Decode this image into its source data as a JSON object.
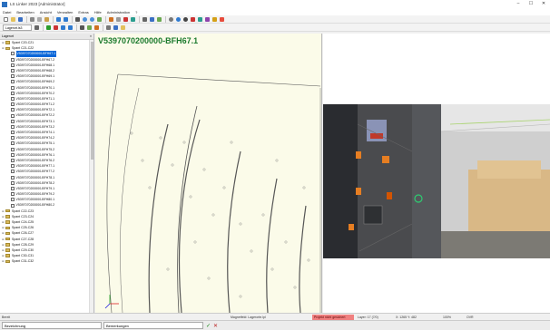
{
  "window": {
    "title": "LS Linker 2023 [Administrator]",
    "min": "–",
    "max": "☐",
    "close": "✕"
  },
  "menu": [
    "Datei",
    "Bearbeiten",
    "Ansicht",
    "Verwalten",
    "Extras",
    "Hilfe",
    "Administration",
    "?"
  ],
  "toolbar3": {
    "group_dropdown": "Lagerort.ls3"
  },
  "tree": {
    "header": "Lagerort",
    "close": "×",
    "items": [
      {
        "label": "Spant C20-C21",
        "type": "folder",
        "level": 0
      },
      {
        "label": "Spant C21-C22",
        "type": "folder",
        "level": 0
      },
      {
        "label": "V5397070200000-BFH67.1",
        "type": "doc",
        "level": 1,
        "selected": true
      },
      {
        "label": "V5397070200000-BFH67.2",
        "type": "doc",
        "level": 1
      },
      {
        "label": "V5397070200000-BFH68.1",
        "type": "doc",
        "level": 1
      },
      {
        "label": "V5397070200000-BFH68.2",
        "type": "doc",
        "level": 1
      },
      {
        "label": "V5397070200000-BFH69.1",
        "type": "doc",
        "level": 1
      },
      {
        "label": "V5397070200000-BFH69.2",
        "type": "doc",
        "level": 1
      },
      {
        "label": "V5397070200000-BFH70.1",
        "type": "doc",
        "level": 1
      },
      {
        "label": "V5397070200000-BFH70.2",
        "type": "doc",
        "level": 1
      },
      {
        "label": "V5397070200000-BFH71.1",
        "type": "doc",
        "level": 1
      },
      {
        "label": "V5397070200000-BFH71.2",
        "type": "doc",
        "level": 1
      },
      {
        "label": "V5397070200000-BFH72.1",
        "type": "doc",
        "level": 1
      },
      {
        "label": "V5397070200000-BFH72.2",
        "type": "doc",
        "level": 1
      },
      {
        "label": "V5397070200000-BFH73.1",
        "type": "doc",
        "level": 1
      },
      {
        "label": "V5397070200000-BFH73.2",
        "type": "doc",
        "level": 1
      },
      {
        "label": "V5397070200000-BFH74.1",
        "type": "doc",
        "level": 1
      },
      {
        "label": "V5397070200000-BFH74.2",
        "type": "doc",
        "level": 1
      },
      {
        "label": "V5397070200000-BFH75.1",
        "type": "doc",
        "level": 1
      },
      {
        "label": "V5397070200000-BFH75.2",
        "type": "doc",
        "level": 1
      },
      {
        "label": "V5397070200000-BFH76.1",
        "type": "doc",
        "level": 1
      },
      {
        "label": "V5397070200000-BFH76.2",
        "type": "doc",
        "level": 1
      },
      {
        "label": "V5397070200000-BFH77.1",
        "type": "doc",
        "level": 1
      },
      {
        "label": "V5397070200000-BFH77.2",
        "type": "doc",
        "level": 1
      },
      {
        "label": "V5397070200000-BFH78.1",
        "type": "doc",
        "level": 1
      },
      {
        "label": "V5397070200000-BFH78.2",
        "type": "doc",
        "level": 1
      },
      {
        "label": "V5397070200000-BFH79.1",
        "type": "doc",
        "level": 1
      },
      {
        "label": "V5397070200000-BFH79.2",
        "type": "doc",
        "level": 1
      },
      {
        "label": "V5397070200000-BFH80.1",
        "type": "doc",
        "level": 1
      },
      {
        "label": "V5397070200000-BFH80.2",
        "type": "doc",
        "level": 1
      },
      {
        "label": "Spant C22-C23",
        "type": "folder",
        "level": 0
      },
      {
        "label": "Spant C23-C24",
        "type": "folder",
        "level": 0
      },
      {
        "label": "Spant C24-C25",
        "type": "folder",
        "level": 0
      },
      {
        "label": "Spant C25-C26",
        "type": "folder",
        "level": 0
      },
      {
        "label": "Spant C26-C27",
        "type": "folder",
        "level": 0
      },
      {
        "label": "Spant C27-C28",
        "type": "folder",
        "level": 0
      },
      {
        "label": "Spant C28-C29",
        "type": "folder",
        "level": 0
      },
      {
        "label": "Spant C29-C30",
        "type": "folder",
        "level": 0
      },
      {
        "label": "Spant C30-C31",
        "type": "folder",
        "level": 0
      },
      {
        "label": "Spant C31-C32",
        "type": "folder",
        "level": 0
      }
    ]
  },
  "viewer2d": {
    "title": "V5397070200000-BFH67.1"
  },
  "status": {
    "left": "Bereit",
    "mid": "Magnetfeld: Lagerorte.lpl",
    "err": "Projekt nicht gesichert",
    "layer": "Layer: 17 (7/0)",
    "coords": "X: 1265  Y: 482",
    "zoom": "100%",
    "extra": "OVR"
  },
  "bottom": {
    "label": "Bezeichnung",
    "value": "Bemerkungen",
    "ok": "✓",
    "cancel": "✕"
  },
  "colors": {
    "accent": "#1b7a2d",
    "selection": "#0a66d8",
    "error": "#f08080",
    "paper": "#fbfbe9"
  }
}
